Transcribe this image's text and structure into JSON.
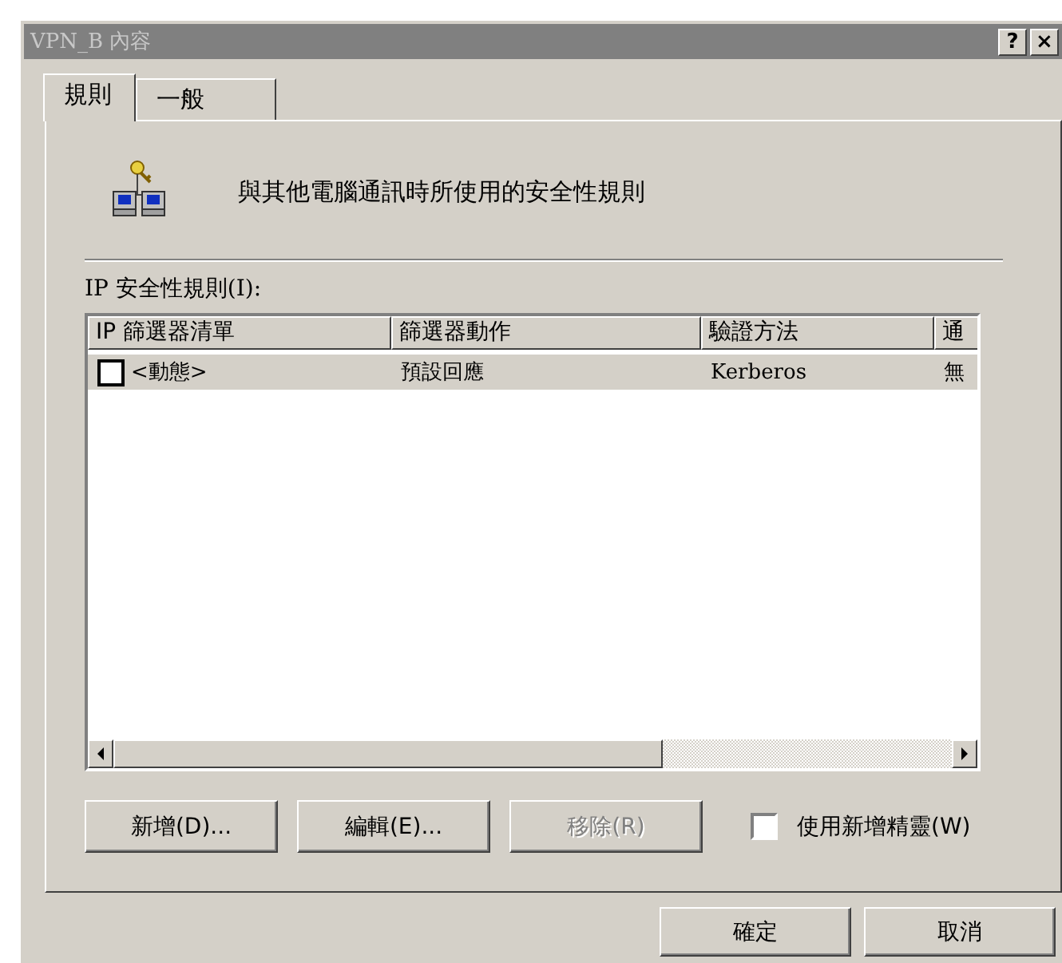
{
  "window": {
    "title": "VPN_B 內容",
    "help": "?",
    "close": "×"
  },
  "tabs": [
    {
      "label": "規則",
      "selected": true
    },
    {
      "label": "一般",
      "selected": false
    }
  ],
  "heading": "與其他電腦通訊時所使用的安全性規則",
  "rules_label": "IP 安全性規則(I):",
  "table": {
    "columns": [
      "IP 篩選器清單",
      "篩選器動作",
      "驗證方法",
      "通"
    ],
    "rows": [
      {
        "checked": false,
        "selected": true,
        "cells": [
          "<動態>",
          "預設回應",
          "Kerberos",
          "無"
        ]
      }
    ]
  },
  "buttons": [
    {
      "label": "新增(D)...",
      "disabled": false
    },
    {
      "label": "編輯(E)...",
      "disabled": false
    },
    {
      "label": "移除(R)",
      "disabled": true
    }
  ],
  "wizard": {
    "label": "使用新增精靈(W)",
    "checked": false
  },
  "dialog_buttons": [
    {
      "label": "確定"
    },
    {
      "label": "取消"
    }
  ]
}
